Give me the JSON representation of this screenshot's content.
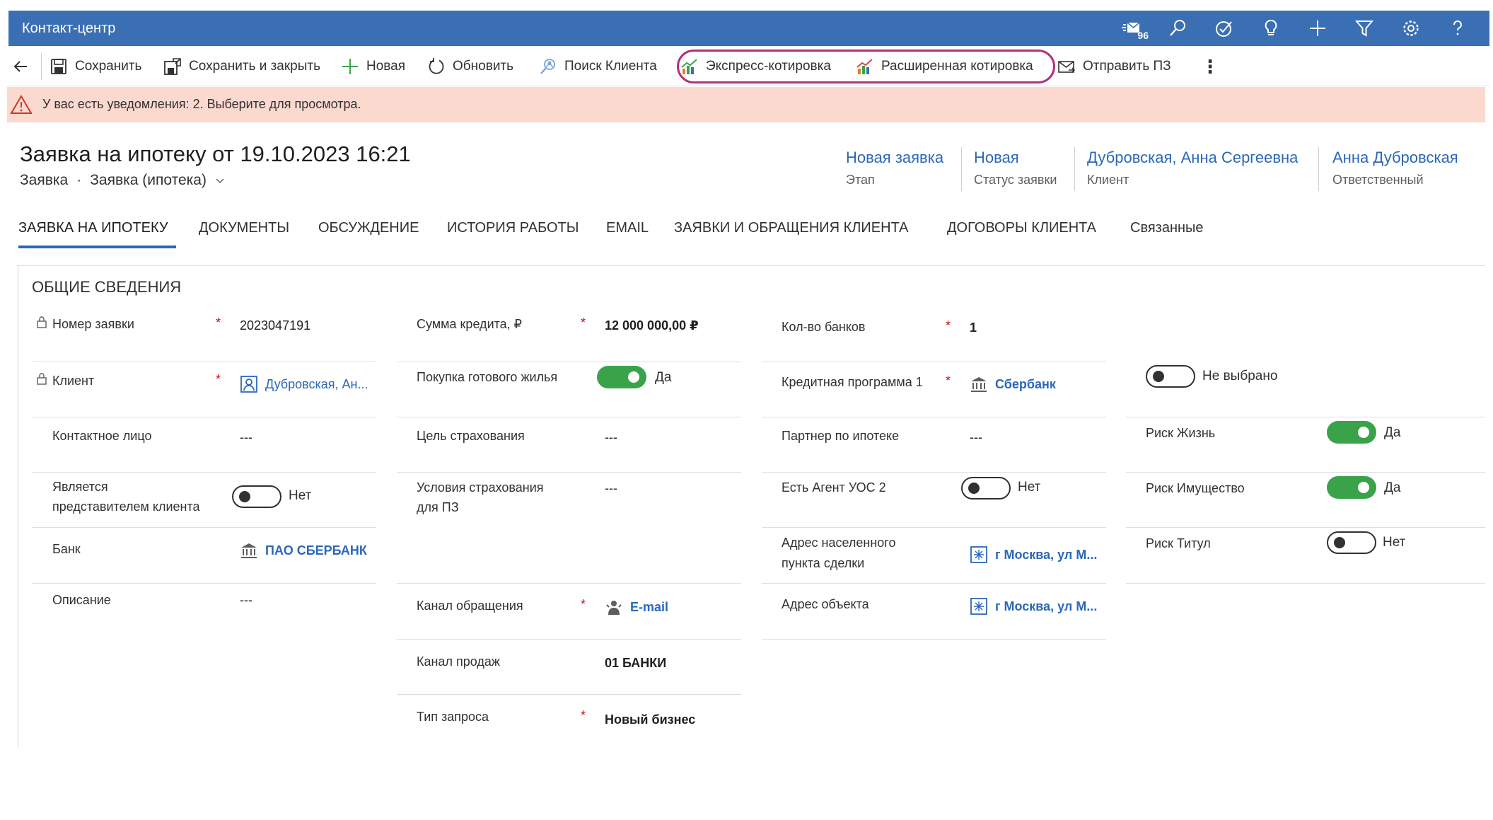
{
  "app": {
    "title": "Контакт-центр",
    "message_count": "96"
  },
  "toolbar": {
    "save": "Сохранить",
    "save_close": "Сохранить и закрыть",
    "new": "Новая",
    "refresh": "Обновить",
    "search_client": "Поиск Клиента",
    "express_quote": "Экспресс-котировка",
    "extended_quote": "Расширенная котировка",
    "send_pz": "Отправить ПЗ"
  },
  "notification": {
    "text": "У вас есть уведомления: 2. Выберите для просмотра."
  },
  "record": {
    "title": "Заявка на ипотеку от  19.10.2023 16:21",
    "entity": "Заявка",
    "form": "Заявка (ипотека)"
  },
  "header_fields": [
    {
      "value": "Новая заявка",
      "label": "Этап"
    },
    {
      "value": "Новая",
      "label": "Статус заявки"
    },
    {
      "value": "Дубровская, Анна Сергеевна",
      "label": "Клиент"
    },
    {
      "value": "Анна Дубровская",
      "label": "Ответственный"
    }
  ],
  "tabs": [
    "ЗАЯВКА НА ИПОТЕКУ",
    "ДОКУМЕНТЫ",
    "ОБСУЖДЕНИЕ",
    "ИСТОРИЯ РАБОТЫ",
    "EMAIL",
    "ЗАЯВКИ И ОБРАЩЕНИЯ КЛИЕНТА",
    "ДОГОВОРЫ КЛИЕНТА",
    "Связанные"
  ],
  "section": {
    "title": "ОБЩИЕ СВЕДЕНИЯ"
  },
  "fields": {
    "request_number": {
      "label": "Номер заявки",
      "value": "2023047191"
    },
    "client": {
      "label": "Клиент",
      "value": "Дубровская, Ан..."
    },
    "contact": {
      "label": "Контактное лицо",
      "value": "---"
    },
    "is_representative": {
      "label1": "Является",
      "label2": "представителем клиента",
      "value": "Нет"
    },
    "bank": {
      "label": "Банк",
      "value": "ПАО СБЕРБАНК"
    },
    "description": {
      "label": "Описание",
      "value": "---"
    },
    "loan_amount": {
      "label": "Сумма кредита, ₽",
      "value": "12 000 000,00 ₽"
    },
    "ready_housing": {
      "label": "Покупка готового жилья",
      "value": "Да"
    },
    "insurance_goal": {
      "label": "Цель страхования",
      "value": "---"
    },
    "insurance_terms": {
      "label1": "Условия страхования",
      "label2": "для ПЗ",
      "value": "---"
    },
    "channel": {
      "label": "Канал обращения",
      "value": "E-mail"
    },
    "sales_channel": {
      "label": "Канал продаж",
      "value": "01 БАНКИ"
    },
    "request_type": {
      "label": "Тип запроса",
      "value": "Новый бизнес"
    },
    "bank_count": {
      "label": "Кол-во банков",
      "value": "1"
    },
    "credit_program": {
      "label": "Кредитная программа 1",
      "value": "Сбербанк"
    },
    "mortgage_partner": {
      "label": "Партнер по ипотеке",
      "value": "---"
    },
    "agent_uos": {
      "label": "Есть Агент УОС 2",
      "value": "Нет"
    },
    "deal_address": {
      "label1": "Адрес населенного",
      "label2": "пункта сделки",
      "value": "г Москва, ул М..."
    },
    "object_address": {
      "label": "Адрес объекта",
      "value": "г Москва, ул М..."
    },
    "not_selected": {
      "value": "Не выбрано"
    },
    "risk_life": {
      "label": "Риск Жизнь",
      "value": "Да"
    },
    "risk_property": {
      "label": "Риск Имущество",
      "value": "Да"
    },
    "risk_title": {
      "label": "Риск Титул",
      "value": "Нет"
    }
  },
  "colors": {
    "header": "#3b6fb3",
    "notification": "#fbd9cf",
    "link": "#2b68b8",
    "toggle_on": "#3aa34a",
    "highlight": "#b52f7b"
  }
}
